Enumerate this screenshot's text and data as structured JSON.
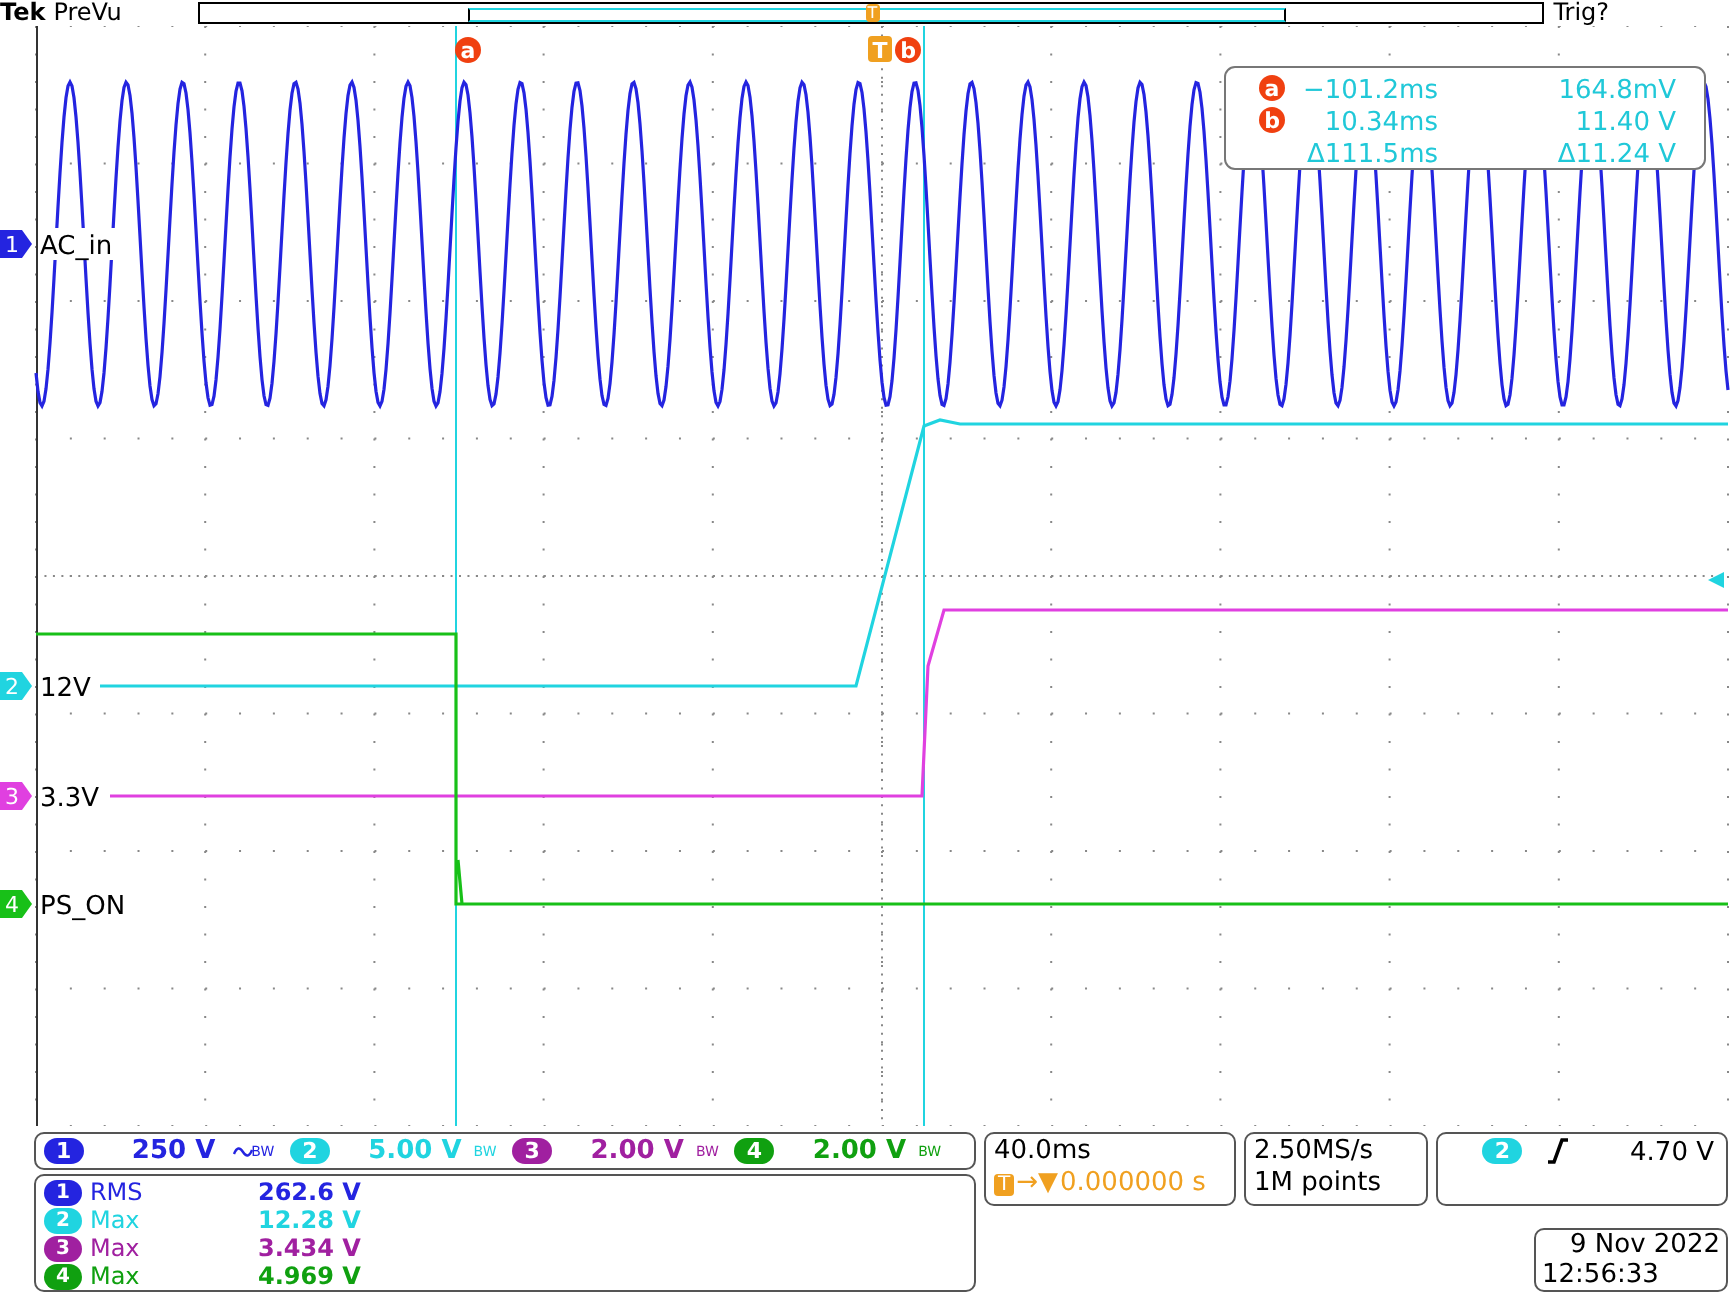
{
  "header": {
    "brand": "Tek",
    "mode": "PreVu",
    "record_trigger_marker": "T",
    "trigger_status": "Trig?"
  },
  "traces": [
    {
      "channel": "1",
      "label": "AC_in",
      "kind": "sine",
      "color": "#2424e0"
    },
    {
      "channel": "2",
      "label": "12V",
      "kind": "ramp",
      "color": "#20d4e0"
    },
    {
      "channel": "3",
      "label": "3.3V",
      "kind": "rise",
      "color": "#e040e0"
    },
    {
      "channel": "4",
      "label": "PS_ON",
      "kind": "fall",
      "color": "#18c018"
    }
  ],
  "cursors": [
    {
      "label": "a",
      "kind": "a"
    },
    {
      "label": "T",
      "kind": "trigger"
    },
    {
      "label": "b",
      "kind": "b"
    }
  ],
  "cursor_readout": [
    {
      "marker": "a",
      "time": "−101.2ms",
      "value": "164.8mV"
    },
    {
      "marker": "b",
      "time": "10.34ms",
      "value": "11.40 V"
    },
    {
      "time": "Δ111.5ms",
      "value": "Δ11.24 V"
    }
  ],
  "channel_scales": [
    {
      "channel": "1",
      "scale": "250 V",
      "color": "#2424e0",
      "ac_coupled": true,
      "bandwidth": "BW"
    },
    {
      "channel": "2",
      "scale": "5.00 V",
      "color": "#20d4e0",
      "ac_coupled": false,
      "bandwidth": "BW"
    },
    {
      "channel": "3",
      "scale": "2.00 V",
      "color": "#a020a0",
      "ac_coupled": false,
      "bandwidth": "BW"
    },
    {
      "channel": "4",
      "scale": "2.00 V",
      "color": "#10a010",
      "ac_coupled": false,
      "bandwidth": "BW"
    }
  ],
  "measurements": [
    {
      "channel": "1",
      "type": "RMS",
      "value": "262.6 V",
      "color": "#2424e0"
    },
    {
      "channel": "2",
      "type": "Max",
      "value": "12.28 V",
      "color": "#20d4e0"
    },
    {
      "channel": "3",
      "type": "Max",
      "value": "3.434 V",
      "color": "#a020a0"
    },
    {
      "channel": "4",
      "type": "Max",
      "value": "4.969 V",
      "color": "#10a010"
    }
  ],
  "timebase": {
    "scale": "40.0ms",
    "trigger_badge": "T",
    "delay_symbol": "→▼",
    "position": "0.000000 s"
  },
  "acquisition": {
    "sample_rate": "2.50MS/s",
    "record_length": "1M points"
  },
  "trigger": {
    "channel": "2",
    "color": "#20d4e0",
    "rising_edge": true,
    "level": "4.70 V"
  },
  "date": "9 Nov 2022",
  "time": "12:56:33"
}
